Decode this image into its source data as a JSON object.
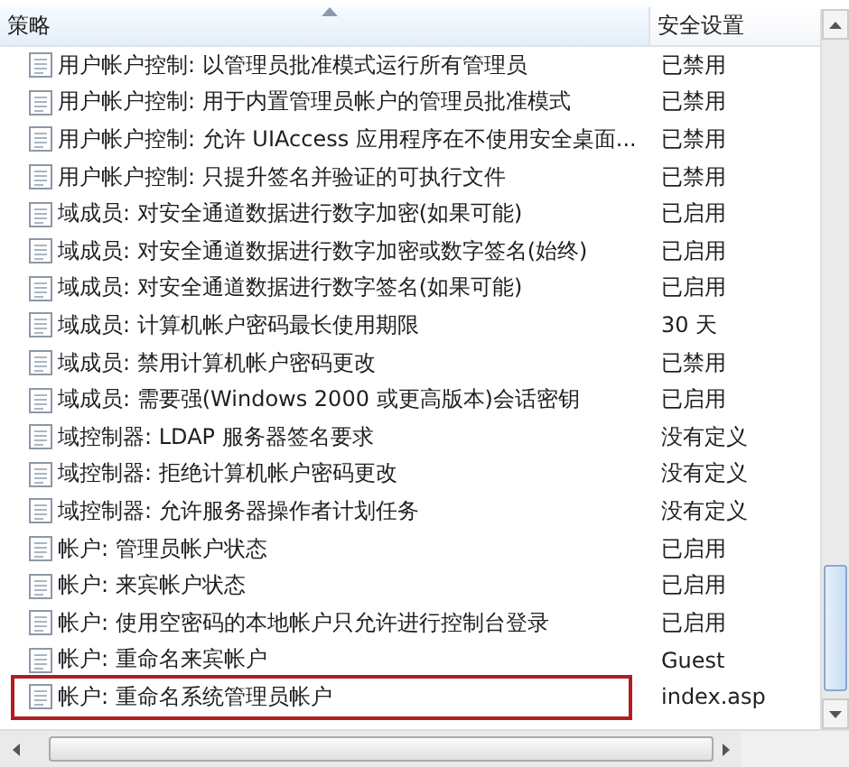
{
  "table": {
    "columns": [
      {
        "label": "策略",
        "sorted": true
      },
      {
        "label": "安全设置",
        "sorted": false
      }
    ],
    "rows": [
      {
        "policy": "用户帐户控制: 以管理员批准模式运行所有管理员",
        "setting": "已禁用",
        "outlined": false
      },
      {
        "policy": "用户帐户控制: 用于内置管理员帐户的管理员批准模式",
        "setting": "已禁用",
        "outlined": false
      },
      {
        "policy": "用户帐户控制: 允许 UIAccess 应用程序在不使用安全桌面...",
        "setting": "已禁用",
        "outlined": false
      },
      {
        "policy": "用户帐户控制: 只提升签名并验证的可执行文件",
        "setting": "已禁用",
        "outlined": false
      },
      {
        "policy": "域成员: 对安全通道数据进行数字加密(如果可能)",
        "setting": "已启用",
        "outlined": false
      },
      {
        "policy": "域成员: 对安全通道数据进行数字加密或数字签名(始终)",
        "setting": "已启用",
        "outlined": false
      },
      {
        "policy": "域成员: 对安全通道数据进行数字签名(如果可能)",
        "setting": "已启用",
        "outlined": false
      },
      {
        "policy": "域成员: 计算机帐户密码最长使用期限",
        "setting": "30 天",
        "outlined": false
      },
      {
        "policy": "域成员: 禁用计算机帐户密码更改",
        "setting": "已禁用",
        "outlined": false
      },
      {
        "policy": "域成员: 需要强(Windows 2000 或更高版本)会话密钥",
        "setting": "已启用",
        "outlined": false
      },
      {
        "policy": "域控制器: LDAP 服务器签名要求",
        "setting": "没有定义",
        "outlined": false
      },
      {
        "policy": "域控制器: 拒绝计算机帐户密码更改",
        "setting": "没有定义",
        "outlined": false
      },
      {
        "policy": "域控制器: 允许服务器操作者计划任务",
        "setting": "没有定义",
        "outlined": false
      },
      {
        "policy": "帐户: 管理员帐户状态",
        "setting": "已启用",
        "outlined": false
      },
      {
        "policy": "帐户: 来宾帐户状态",
        "setting": "已启用",
        "outlined": false
      },
      {
        "policy": "帐户: 使用空密码的本地帐户只允许进行控制台登录",
        "setting": "已启用",
        "outlined": false
      },
      {
        "policy": "帐户: 重命名来宾帐户",
        "setting": "Guest",
        "outlined": false
      },
      {
        "policy": "帐户: 重命名系统管理员帐户",
        "setting": "index.asp",
        "outlined": true
      }
    ]
  }
}
